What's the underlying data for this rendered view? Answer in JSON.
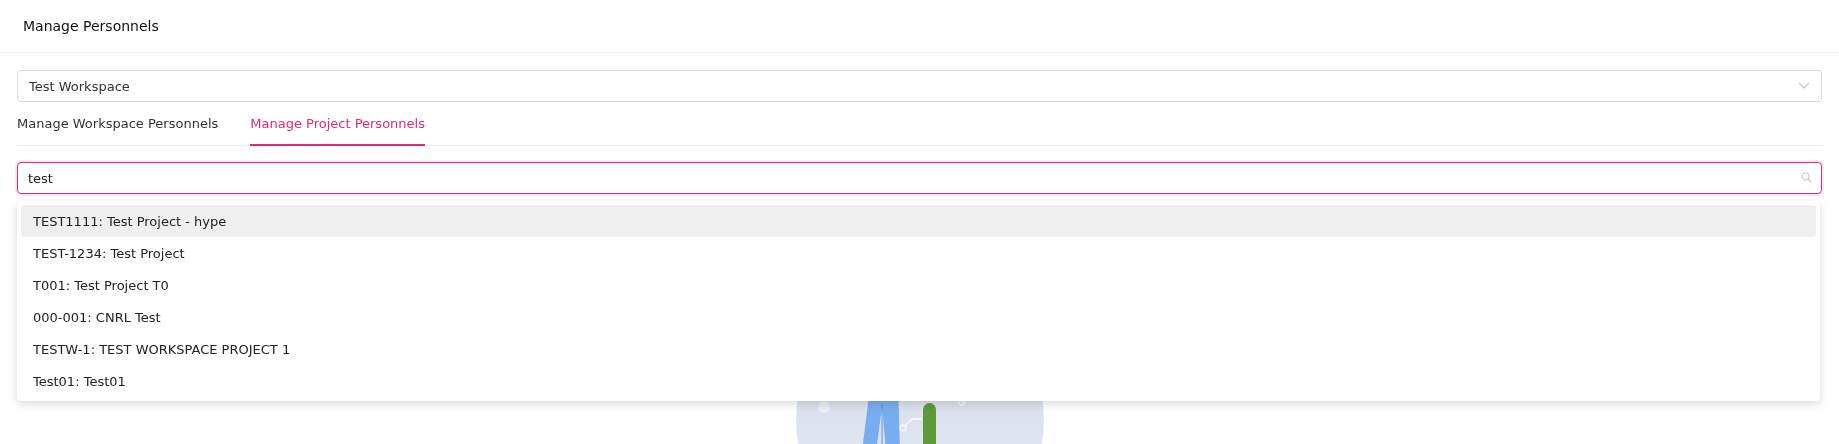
{
  "header": {
    "title": "Manage Personnels"
  },
  "workspace_select": {
    "value": "Test Workspace"
  },
  "tabs": [
    {
      "label": "Manage Workspace Personnels",
      "selected": false
    },
    {
      "label": "Manage Project Personnels",
      "selected": true
    }
  ],
  "search": {
    "value": "test"
  },
  "dropdown": {
    "items": [
      {
        "label": "TEST1111: Test Project - hype",
        "selected": true
      },
      {
        "label": "TEST-1234: Test Project",
        "selected": false
      },
      {
        "label": "T001: Test Project T0",
        "selected": false
      },
      {
        "label": "000-001: CNRL Test",
        "selected": false
      },
      {
        "label": "TESTW-1: TEST WORKSPACE PROJECT 1",
        "selected": false
      },
      {
        "label": "Test01: Test01",
        "selected": false
      }
    ]
  }
}
